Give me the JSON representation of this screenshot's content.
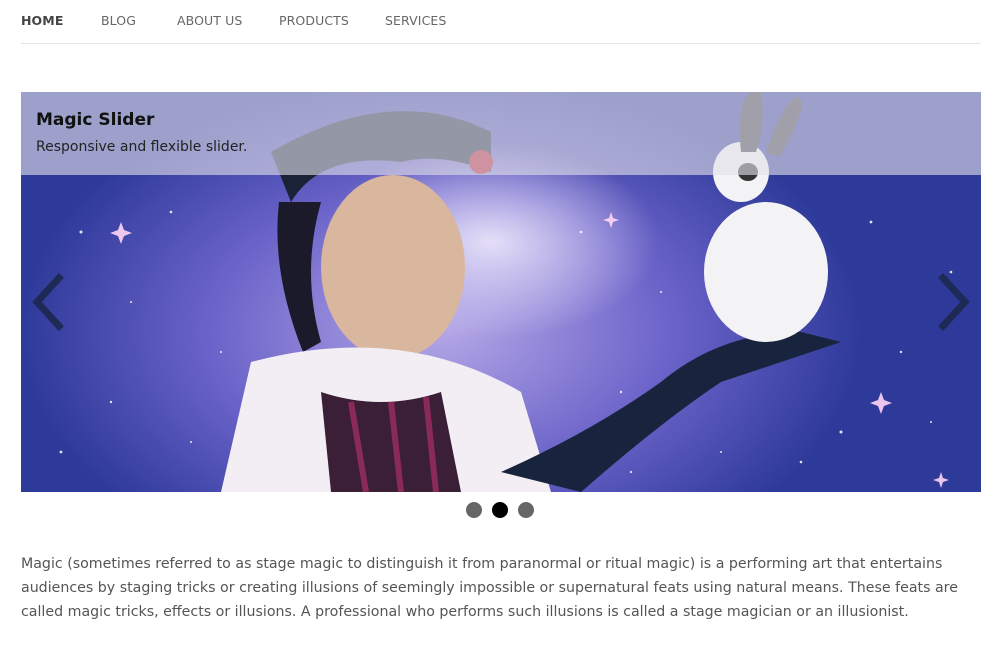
{
  "nav": {
    "items": [
      {
        "label": "HOME",
        "active": true
      },
      {
        "label": "BLOG",
        "active": false
      },
      {
        "label": "ABOUT US",
        "active": false
      },
      {
        "label": "PRODUCTS",
        "active": false
      },
      {
        "label": "SERVICES",
        "active": false
      }
    ]
  },
  "slider": {
    "caption_title": "Magic Slider",
    "caption_subtitle": "Responsive and flexible slider.",
    "prev_icon": "chevron-left-icon",
    "next_icon": "chevron-right-icon",
    "slide_count": 3,
    "active_slide": 2
  },
  "article": {
    "text": "Magic (sometimes referred to as stage magic to distinguish it from paranormal or ritual magic) is a performing art that entertains audiences by staging tricks or creating illusions of seemingly impossible or supernatural feats using natural means. These feats are called magic tricks, effects or illusions. A professional who performs such illusions is called a stage magician or an illusionist."
  },
  "colors": {
    "nav_text": "#666666",
    "nav_active": "#444444",
    "dot_inactive": "#666666",
    "dot_active": "#000000",
    "caption_band": "#e1dee8",
    "body_text": "#555555"
  }
}
